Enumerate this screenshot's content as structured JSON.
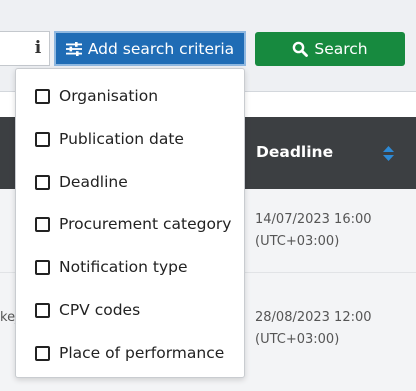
{
  "toolbar": {
    "info_glyph": "i",
    "add_criteria_label": "Add search criteria",
    "search_label": "Search"
  },
  "table": {
    "deadline_header": "Deadline",
    "rows": [
      {
        "deadline_date": "14/07/2023 16:00",
        "deadline_tz": "(UTC+03:00)",
        "truncated_text": ""
      },
      {
        "deadline_date": "28/08/2023 12:00",
        "deadline_tz": "(UTC+03:00)",
        "truncated_text": "kej"
      }
    ]
  },
  "criteria_menu": {
    "items": [
      "Organisation",
      "Publication date",
      "Deadline",
      "Procurement category",
      "Notification type",
      "CPV codes",
      "Place of performance"
    ]
  },
  "colors": {
    "primary_blue": "#1f6cb5",
    "search_green": "#178a3f",
    "header_dark": "#3c3f42",
    "sort_icon_blue": "#2d8ad6"
  }
}
